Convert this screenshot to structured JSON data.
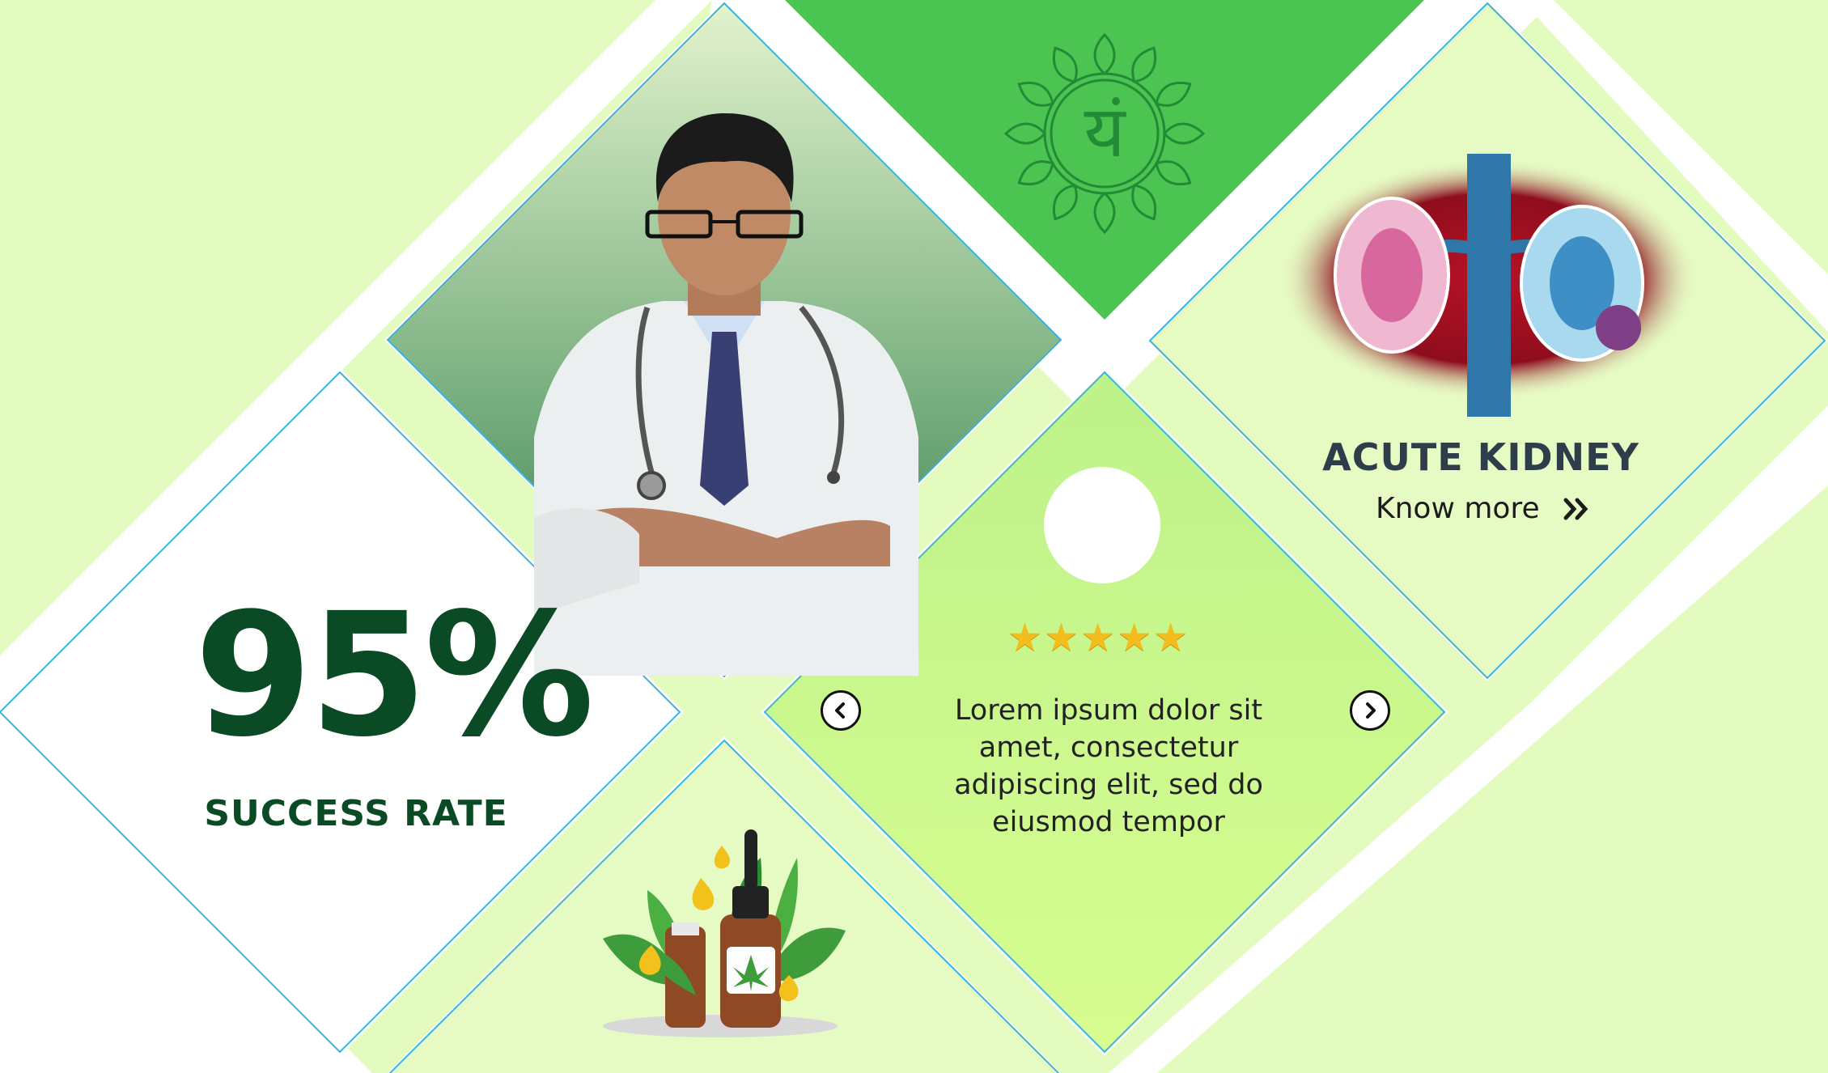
{
  "colors": {
    "background": "#e4fbc0",
    "tile_white": "#ffffff",
    "tile_light_green": "#e6fbc4",
    "chakra_green": "#4cc452",
    "testimonial_green": "#d4fc8c",
    "border_blue": "#37b4e0",
    "heading_dark_green": "#0a4a24",
    "kidney_heading": "#2d3e4a",
    "star_gold": "#f3bd1e"
  },
  "stats": {
    "percentage": "95%",
    "label": "SUCCESS RATE"
  },
  "feature_card": {
    "title": "ACUTE KIDNEY",
    "link_label": "Know more",
    "link_icon": "double-chevron-right-icon"
  },
  "testimonial": {
    "rating": 5,
    "max_rating": 5,
    "text": "Lorem ipsum dolor sit amet, consectetur adipiscing elit, sed do eiusmod tempor",
    "prev_icon": "chevron-left-icon",
    "next_icon": "chevron-right-icon"
  },
  "chakra_symbol": "यं",
  "images": {
    "doctor": "doctor-photo",
    "kidney": "kidney-illustration",
    "oil": "cbd-oil-bottles-illustration",
    "chakra": "heart-chakra-icon"
  }
}
